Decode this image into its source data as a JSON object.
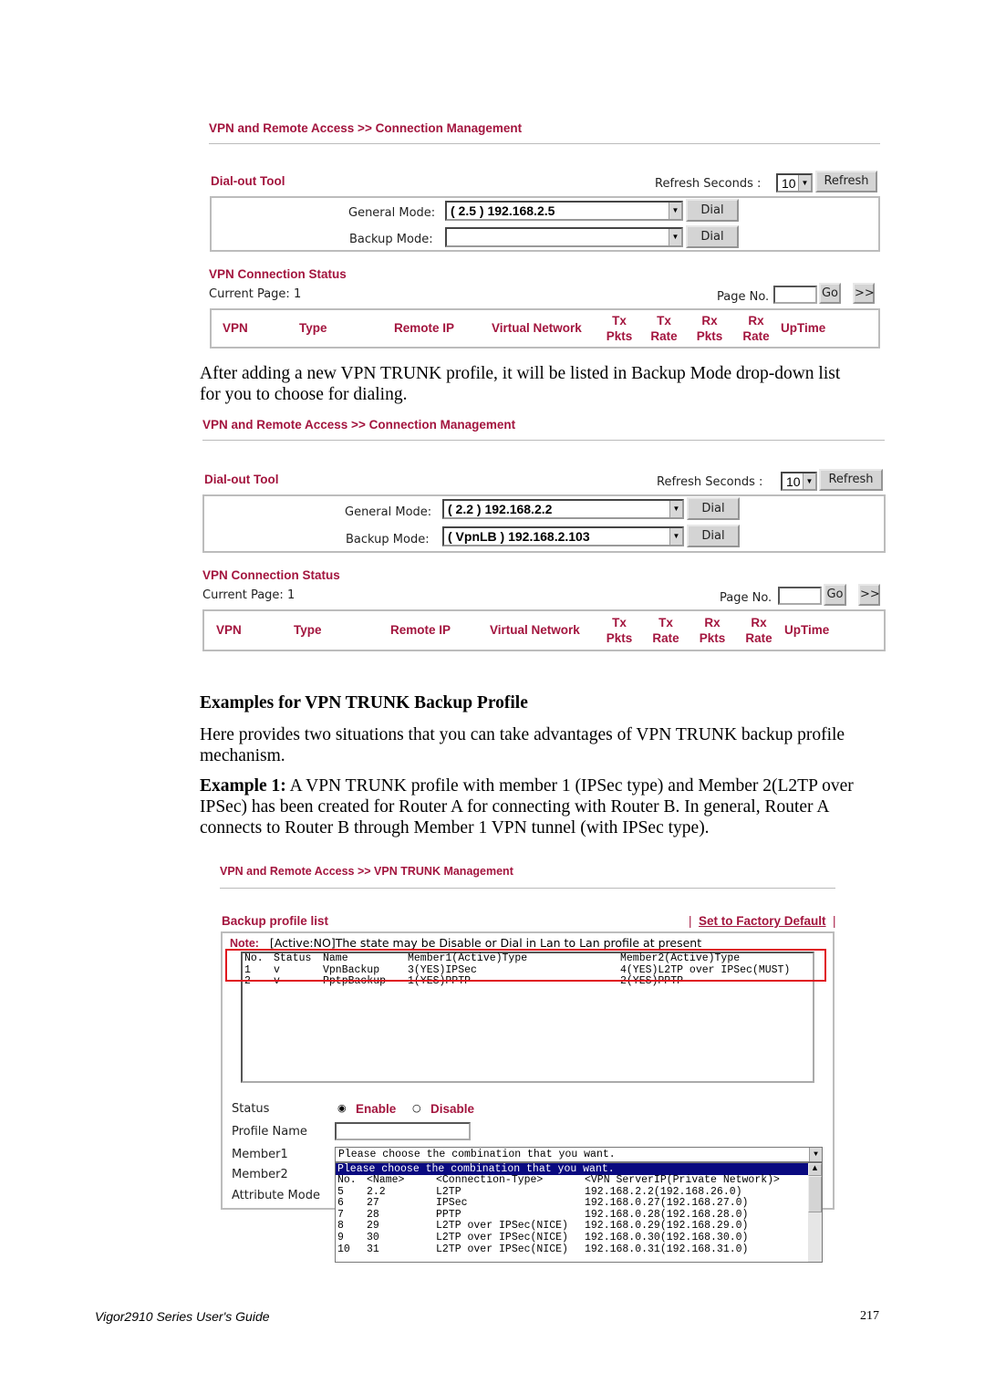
{
  "shot1": {
    "breadcrumb": "VPN and Remote Access >> Connection Management",
    "dialout_title": "Dial-out Tool",
    "refresh_label": "Refresh Seconds :",
    "refresh_value": "10",
    "refresh_button": "Refresh",
    "general_label": "General Mode:",
    "general_value": "( 2.5 ) 192.168.2.5",
    "backup_label": "Backup Mode:",
    "backup_value": "",
    "dial": "Dial",
    "status_title": "VPN Connection Status",
    "current_page": "Current Page: 1",
    "page_no": "Page No.",
    "go": "Go",
    "next": ">>",
    "headers": {
      "vpn": "VPN",
      "type": "Type",
      "remote": "Remote IP",
      "vnet": "Virtual Network",
      "txp": "Tx Pkts",
      "txr": "Tx Rate",
      "rxp": "Rx Pkts",
      "rxr": "Rx Rate",
      "up": "UpTime"
    }
  },
  "para1a": "After adding a new VPN TRUNK profile, it will be listed in Backup Mode drop-down list",
  "para1b": "for you to choose for dialing.",
  "shot2": {
    "breadcrumb": "VPN and Remote Access >> Connection Management",
    "dialout_title": "Dial-out Tool",
    "refresh_label": "Refresh Seconds :",
    "refresh_value": "10",
    "refresh_button": "Refresh",
    "general_label": "General Mode:",
    "general_value": "( 2.2 ) 192.168.2.2",
    "backup_label": "Backup Mode:",
    "backup_value": "( VpnLB ) 192.168.2.103",
    "dial": "Dial",
    "status_title": "VPN Connection Status",
    "current_page": "Current Page: 1",
    "page_no": "Page No.",
    "go": "Go",
    "next": ">>",
    "headers": {
      "vpn": "VPN",
      "type": "Type",
      "remote": "Remote IP",
      "vnet": "Virtual Network",
      "txp": "Tx Pkts",
      "txr": "Tx Rate",
      "rxp": "Rx Pkts",
      "rxr": "Rx Rate",
      "up": "UpTime"
    }
  },
  "heading": "Examples for VPN TRUNK Backup Profile",
  "para2a": "Here provides two situations that you can take advantages of VPN TRUNK backup profile",
  "para2b": "mechanism.",
  "ex1_label": "Example 1:",
  "ex1a": " A VPN TRUNK profile with member 1 (IPSec type) and Member 2(L2TP over",
  "ex1b": "IPSec) has been created for Router A for connecting with Router B. In general, Router A",
  "ex1c": "connects to Router B through Member 1 VPN tunnel (with IPSec type).",
  "shot3": {
    "breadcrumb": "VPN and Remote Access >> VPN TRUNK Management",
    "list_title": "Backup profile list",
    "factory": "Set to Factory Default",
    "note_label": "Note:",
    "note": "[Active:NO]The state may be Disable or Dial in Lan to Lan profile at present",
    "list_header": [
      "No.",
      "Status",
      "Name",
      "Member1(Active)Type",
      "Member2(Active)Type"
    ],
    "list_rows": [
      [
        "1",
        "v",
        "VpnBackup",
        "3(YES)IPSec",
        "4(YES)L2TP over IPSec(MUST)"
      ],
      [
        "2",
        "v",
        "PptpBackup",
        "1(YES)PPTP",
        "2(YES)PPTP"
      ]
    ],
    "status_label": "Status",
    "enable": "Enable",
    "disable": "Disable",
    "status_value": "Enable",
    "profile_label": "Profile Name",
    "member1_label": "Member1",
    "member2_label": "Member2",
    "attr_label": "Attribute Mode",
    "member1_value": "Please choose the combination that you want.",
    "dropdown_highlight": "Please choose the combination that you want.",
    "dropdown_header": [
      "No.",
      "<Name>",
      "<Connection-Type>",
      "<VPN ServerIP(Private Network)>"
    ],
    "dropdown_rows": [
      [
        "5",
        "2.2",
        "L2TP",
        "192.168.2.2(192.168.26.0)"
      ],
      [
        "6",
        "27",
        "IPSec",
        "192.168.0.27(192.168.27.0)"
      ],
      [
        "7",
        "28",
        "PPTP",
        "192.168.0.28(192.168.28.0)"
      ],
      [
        "8",
        "29",
        "L2TP over IPSec(NICE)",
        "192.168.0.29(192.168.29.0)"
      ],
      [
        "9",
        "30",
        "L2TP over IPSec(NICE)",
        "192.168.0.30(192.168.30.0)"
      ],
      [
        "10",
        "31",
        "L2TP over IPSec(NICE)",
        "192.168.0.31(192.168.31.0)"
      ]
    ]
  },
  "footer": {
    "guide": "Vigor2910 Series User's Guide",
    "page": "217"
  },
  "colors": {
    "accent": "#a3153e",
    "highlight": "#0a0a80",
    "callout": "#e0141e"
  }
}
